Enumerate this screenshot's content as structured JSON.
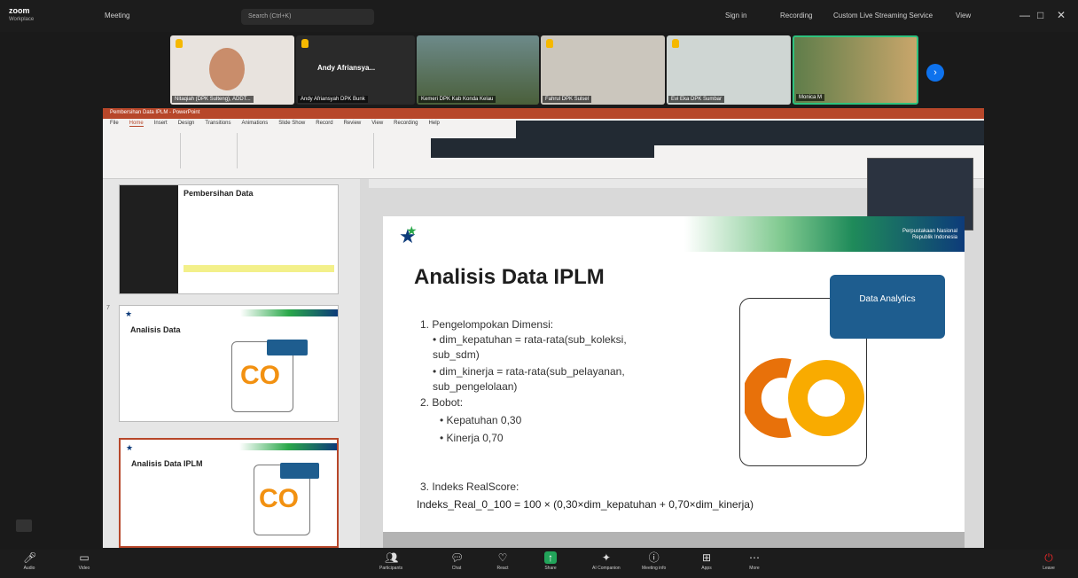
{
  "topbar": {
    "logo": "zoom",
    "logo_sub": "Workplace",
    "meeting_label": "Meeting",
    "search_placeholder": "Search (Ctrl+K)",
    "right_items": [
      "Sign in",
      "Recording",
      "Custom Live Streaming Service",
      "View"
    ]
  },
  "participants": [
    {
      "name": "Nitaqiah (DPK Sulteng), ADDT...",
      "hand": true
    },
    {
      "name": "Andy Afriansyah DPK Bunk",
      "display": "Andy Afriansya...",
      "hand": true
    },
    {
      "name": "Kemeri DPK Kab Konda Kelau",
      "hand": false
    },
    {
      "name": "Fahrul DPK Sulsel",
      "hand": true
    },
    {
      "name": "Evi Eka DPK Sumbar",
      "hand": true
    },
    {
      "name": "Monica M",
      "hand": false
    }
  ],
  "ppt": {
    "title": "Pembersihan Data IPLM - PowerPoint",
    "menu": [
      "File",
      "Home",
      "Insert",
      "Design",
      "Transitions",
      "Animations",
      "Slide Show",
      "Record",
      "Review",
      "View",
      "Recording",
      "Help"
    ]
  },
  "thumbnails": [
    {
      "num": "",
      "title": "Pembersihan Data"
    },
    {
      "num": "7",
      "title": "Analisis Data"
    },
    {
      "num": "8",
      "title": "Analisis Data IPLM"
    }
  ],
  "slide": {
    "title": "Analisis Data IPLM",
    "items": [
      "1. Pengelompokan Dimensi:",
      "•  dim_kepatuhan = rata-rata(sub_koleksi,",
      "   sub_sdm)",
      "•  dim_kinerja   = rata-rata(sub_pelayanan,",
      "   sub_pengelolaan)",
      "2. Bobot:",
      "•  Kepatuhan 0,30",
      "•  Kinerja  0,70",
      "3. Indeks RealScore:"
    ],
    "formula": "Indeks_Real_0_100 = 100 × (0,30×dim_kepatuhan + 0,70×dim_kinerja)",
    "box_label": "Data Analytics",
    "logo_text": "CO",
    "tag_line1": "Perpustakaan Nasional",
    "tag_line2": "Republik Indonesia"
  },
  "bottombar": [
    "Audio",
    "Video",
    "Participants",
    "Chat",
    "React",
    "Share",
    "AI Companion",
    "Meeting info",
    "Apps",
    "More",
    "Leave"
  ],
  "colors": {
    "accent": "#b7472a",
    "zoom_blue": "#0e72ed",
    "box": "#1e5d8f",
    "orange": "#f29111"
  }
}
